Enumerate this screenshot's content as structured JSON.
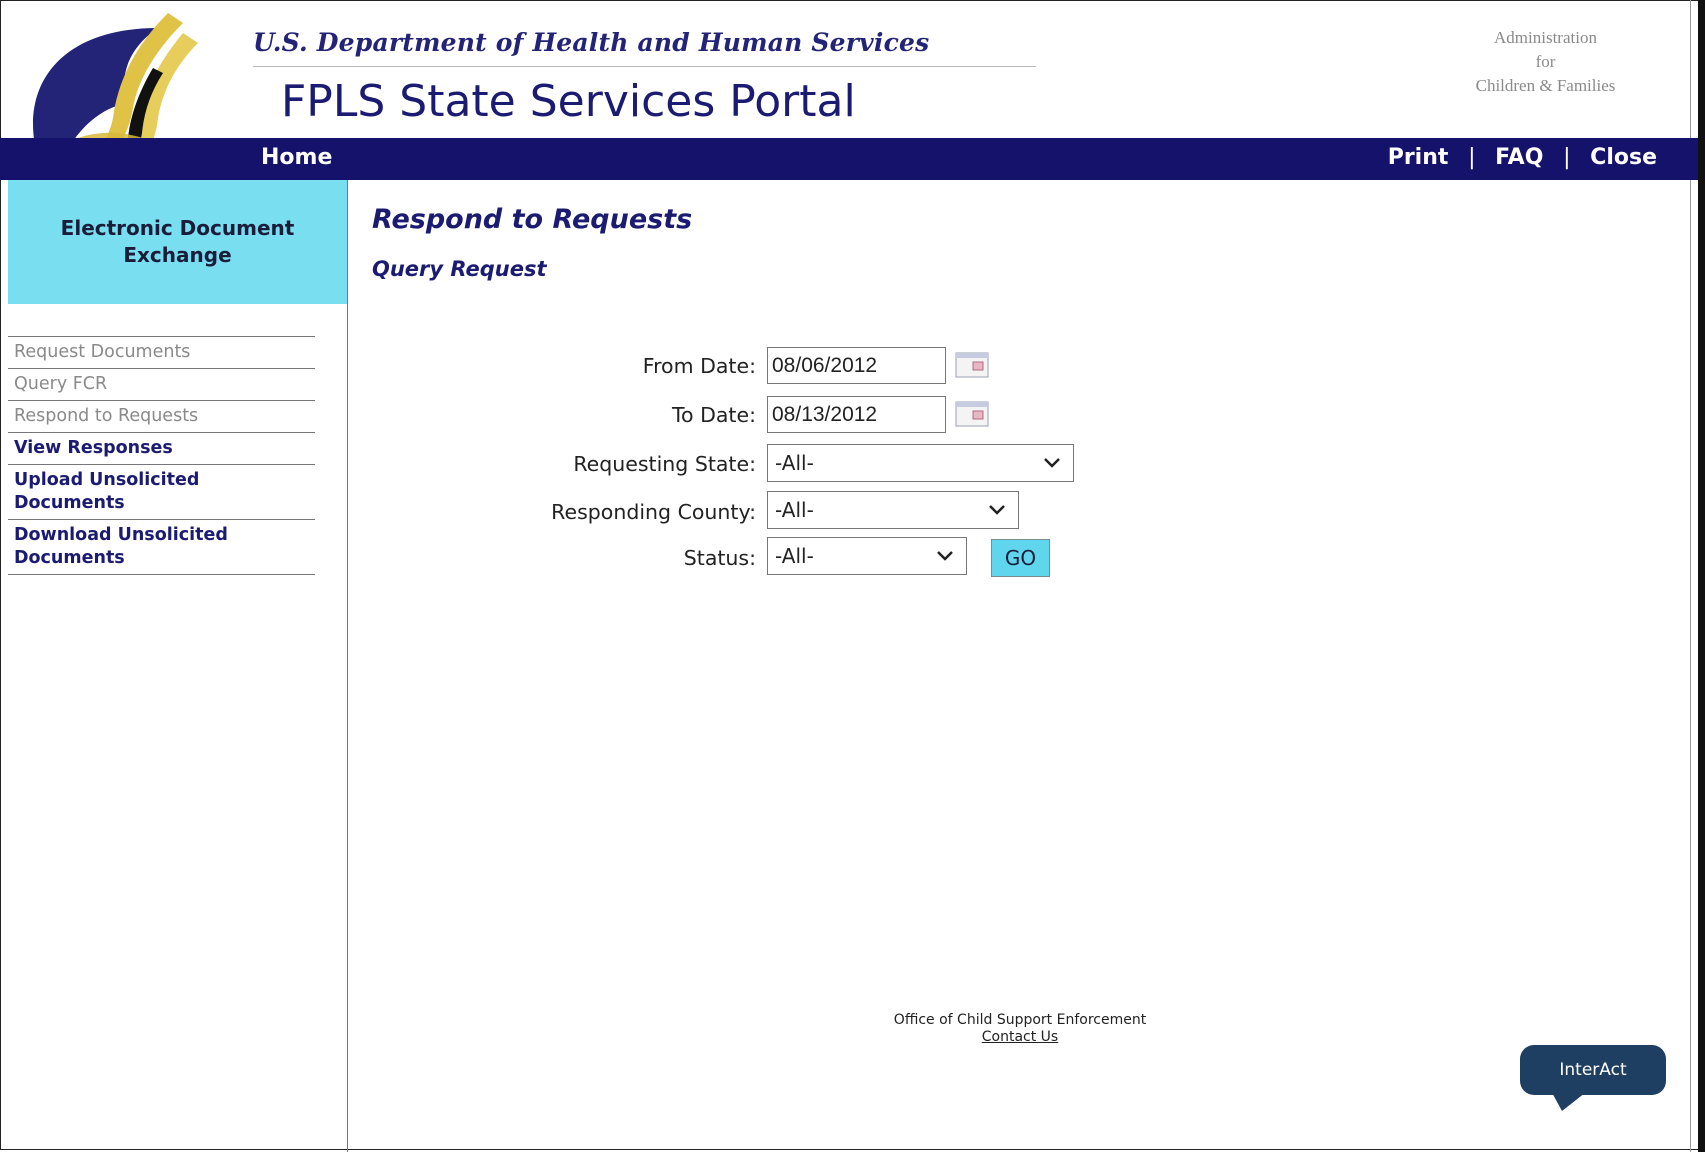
{
  "header": {
    "department": "U.S. Department of Health and Human Services",
    "portal_title": "FPLS State Services Portal",
    "agency_line1": "Administration",
    "agency_line2": "for",
    "agency_line3": "Children & Families"
  },
  "nav": {
    "home": "Home",
    "print": "Print",
    "faq": "FAQ",
    "close": "Close",
    "separator": "|"
  },
  "sidebar": {
    "title_line1": "Electronic Document",
    "title_line2": "Exchange",
    "items": [
      {
        "line1": "Request Documents",
        "line2": ""
      },
      {
        "line1": "Query FCR",
        "line2": ""
      },
      {
        "line1": "Respond to Requests",
        "line2": ""
      },
      {
        "line1": "View Responses",
        "line2": ""
      },
      {
        "line1": "Upload Unsolicited",
        "line2": "Documents"
      },
      {
        "line1": "Download Unsolicited",
        "line2": "Documents"
      }
    ]
  },
  "main": {
    "title": "Respond to Requests",
    "subtitle": "Query Request"
  },
  "form": {
    "from_date_label": "From Date:",
    "from_date_value": "08/06/2012",
    "to_date_label": "To Date:",
    "to_date_value": "08/13/2012",
    "requesting_state_label": "Requesting State:",
    "requesting_state_value": "-All-",
    "responding_county_label": "Responding County:",
    "responding_county_value": "-All-",
    "status_label": "Status:",
    "status_value": "-All-",
    "go_label": "GO"
  },
  "footer": {
    "office": "Office of Child Support Enforcement",
    "contact": "Contact Us"
  },
  "widget": {
    "interact_label": "InterAct"
  },
  "colors": {
    "navbar": "#15126b",
    "sidebar_title_bg": "#79def0",
    "go_button": "#5fd6ee",
    "title_text": "#1b1b72",
    "interact_bubble": "#1f3f62"
  }
}
